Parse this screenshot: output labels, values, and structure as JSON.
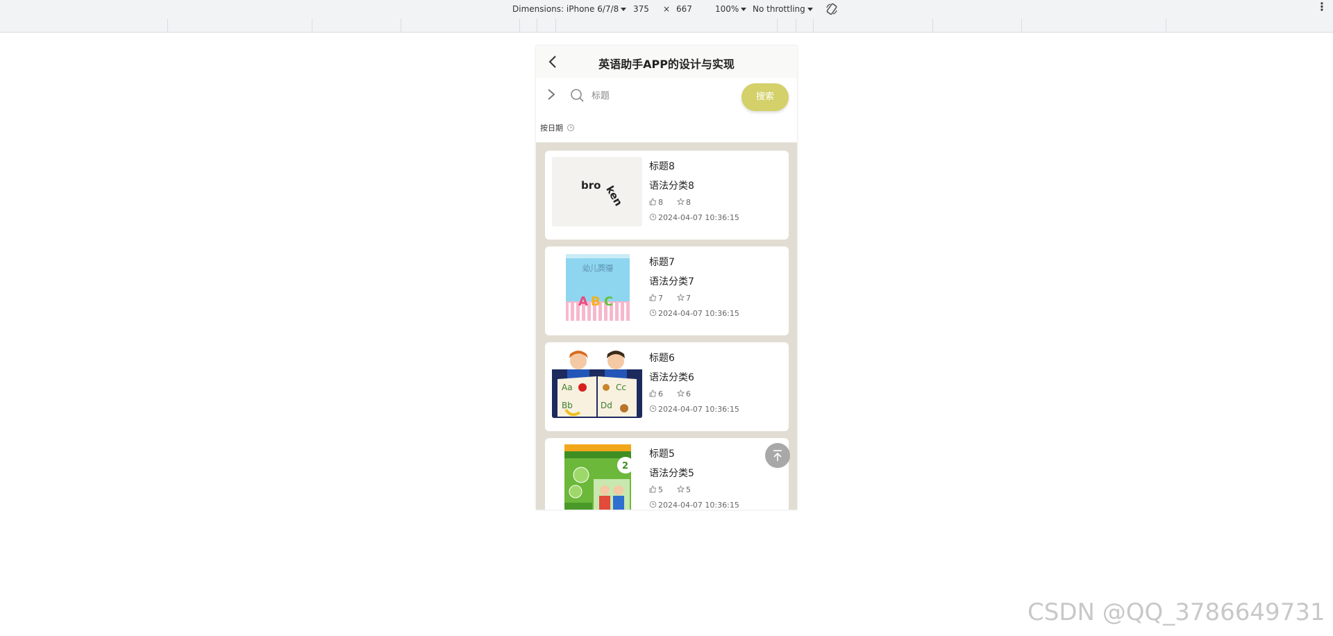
{
  "devtools": {
    "dimensions_label": "Dimensions: iPhone 6/7/8",
    "width": "375",
    "times": "×",
    "height": "667",
    "zoom": "100%",
    "throttling": "No throttling"
  },
  "app": {
    "title": "英语助手APP的设计与实现",
    "search": {
      "placeholder": "标题",
      "button": "搜索"
    },
    "sort_label": "按日期",
    "colors": {
      "accent": "#d4d06a",
      "list_bg": "#e2ddd3"
    },
    "items": [
      {
        "title": "标题8",
        "category": "语法分类8",
        "likes": "8",
        "favorites": "8",
        "date": "2024-04-07 10:36:15",
        "image": "broken-image"
      },
      {
        "title": "标题7",
        "category": "语法分类7",
        "likes": "7",
        "favorites": "7",
        "date": "2024-04-07 10:36:15",
        "image": "abc-book-cover",
        "image_text": "幼儿英语"
      },
      {
        "title": "标题6",
        "category": "语法分类6",
        "likes": "6",
        "favorites": "6",
        "date": "2024-04-07 10:36:15",
        "image": "kids-reading-illustration"
      },
      {
        "title": "标题5",
        "category": "语法分类5",
        "likes": "5",
        "favorites": "5",
        "date": "2024-04-07 10:36:15",
        "image": "english-textbook-cover"
      }
    ]
  },
  "watermark": "CSDN @QQ_3786649731"
}
